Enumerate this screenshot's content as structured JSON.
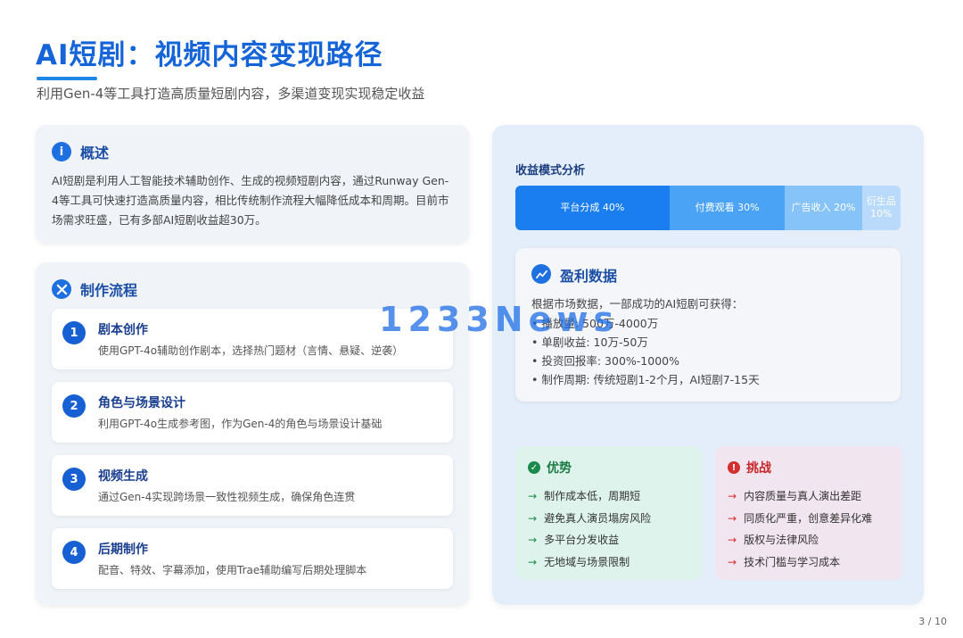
{
  "header": {
    "title": "AI短剧：视频内容变现路径",
    "subtitle": "利用Gen-4等工具打造高质量短剧内容，多渠道变现实现稳定收益"
  },
  "overview": {
    "title": "概述",
    "text": "AI短剧是利用人工智能技术辅助创作、生成的视频短剧内容，通过Runway Gen-4等工具可快速打造高质量内容，相比传统制作流程大幅降低成本和周期。目前市场需求旺盛，已有多部AI短剧收益超30万。"
  },
  "workflow": {
    "title": "制作流程",
    "steps": [
      {
        "num": "1",
        "title": "剧本创作",
        "desc": "使用GPT-4o辅助创作剧本，选择热门题材（言情、悬疑、逆袭）"
      },
      {
        "num": "2",
        "title": "角色与场景设计",
        "desc": "利用GPT-4o生成参考图，作为Gen-4的角色与场景设计基础"
      },
      {
        "num": "3",
        "title": "视频生成",
        "desc": "通过Gen-4实现跨场景一致性视频生成，确保角色连贯"
      },
      {
        "num": "4",
        "title": "后期制作",
        "desc": "配音、特效、字幕添加，使用Trae辅助编写后期处理脚本"
      }
    ]
  },
  "revenue": {
    "label": "收益模式分析",
    "segments": [
      {
        "label": "平台分成 40%",
        "percent": 40,
        "color": "#1a7ef0"
      },
      {
        "label": "付费观看 30%",
        "percent": 30,
        "color": "#4aa3f5"
      },
      {
        "label": "广告收入 20%",
        "percent": 20,
        "color": "#86c3f8"
      },
      {
        "label": "衍生品 10%",
        "percent": 10,
        "color": "#b9dafb"
      }
    ]
  },
  "profit": {
    "title": "盈利数据",
    "intro": "根据市场数据，一部成功的AI短剧可获得：",
    "items": [
      "播放量: 500万-4000万",
      "单剧收益: 10万-50万",
      "投资回报率: 300%-1000%",
      "制作周期: 传统短剧1-2个月，AI短剧7-15天"
    ]
  },
  "pros": {
    "title": "优势",
    "icon": "check-icon",
    "color": "#1b8a4c",
    "items": [
      "制作成本低，周期短",
      "避免真人演员塌房风险",
      "多平台分发收益",
      "无地域与场景限制"
    ]
  },
  "cons": {
    "title": "挑战",
    "icon": "alert-icon",
    "color": "#d32f2f",
    "items": [
      "内容质量与真人演出差距",
      "同质化严重，创意差异化难",
      "版权与法律风险",
      "技术门槛与学习成本"
    ]
  },
  "watermark": "1233News",
  "page_number": "3 / 10"
}
